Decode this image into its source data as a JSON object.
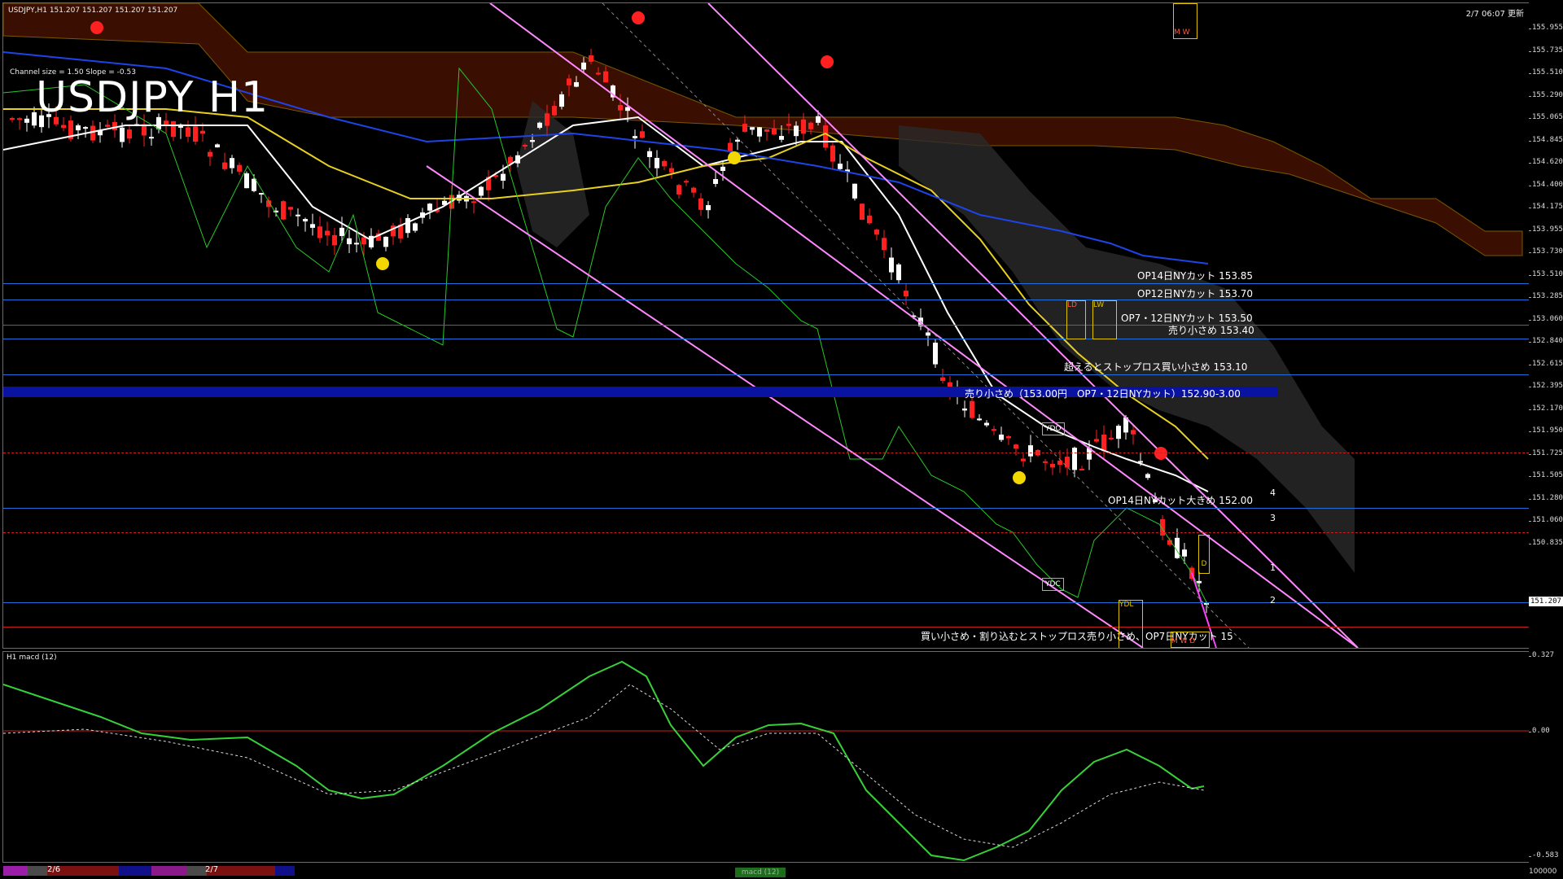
{
  "symbol_header": "USDJPY,H1  151.207 151.207 151.207 151.207",
  "title": "USDJPY H1",
  "channel_info": "Channel size = 1.50 Slope = -0.53",
  "datetime": "2/7 06:07 更新",
  "price_axis": [
    "155.955",
    "155.735",
    "155.510",
    "155.290",
    "155.065",
    "154.845",
    "154.620",
    "154.400",
    "154.175",
    "153.955",
    "153.730",
    "153.510",
    "153.285",
    "153.060",
    "152.840",
    "152.615",
    "152.395",
    "152.170",
    "151.950",
    "151.725",
    "151.505",
    "151.280",
    "151.060",
    "150.835"
  ],
  "current_price": "151.207",
  "macd_axis": [
    "0.327",
    "0.00",
    "-0.583"
  ],
  "macd_label": "H1  macd (12)",
  "bottom_axis_value": "100000",
  "notes": {
    "op14_1": "OP14日NYカット 153.85",
    "op12": "OP12日NYカット 153.70",
    "op7_12": "OP7・12日NYカット 153.50",
    "sell_small": "売り小さめ 153.40",
    "stoploss_buy": "超えるとストップロス買い小さめ 153.10",
    "band_text": "売り小さめ（153.00円　OP7・12日NYカット）152.90-3.00",
    "op14_2": "OP14日NYカット大きめ 152.00",
    "buy_small": "買い小さめ・割り込むとストップロス売り小さめ、OP7日NYカット 15"
  },
  "boxes": {
    "ydo": "YDO",
    "ydc": "YDC",
    "ydl": "YDL",
    "d": "D",
    "m": "M",
    "w": "W",
    "lw": "LW",
    "ld": "LD",
    "mw_m": "M",
    "mw_w": "W"
  },
  "channel_nums": [
    "4",
    "3",
    "1",
    "2"
  ],
  "bottom_dates": [
    "2/6",
    "2/7"
  ],
  "scroll_label": "macd (12)",
  "colors": {
    "blue_line": "#1e6fd9",
    "band": "#0a12a0",
    "red_line": "#c81e1e",
    "ichimoku_cloud": "#ff3b00",
    "macd_up": "#38d038",
    "macd_down": "#ff8ca8"
  }
}
